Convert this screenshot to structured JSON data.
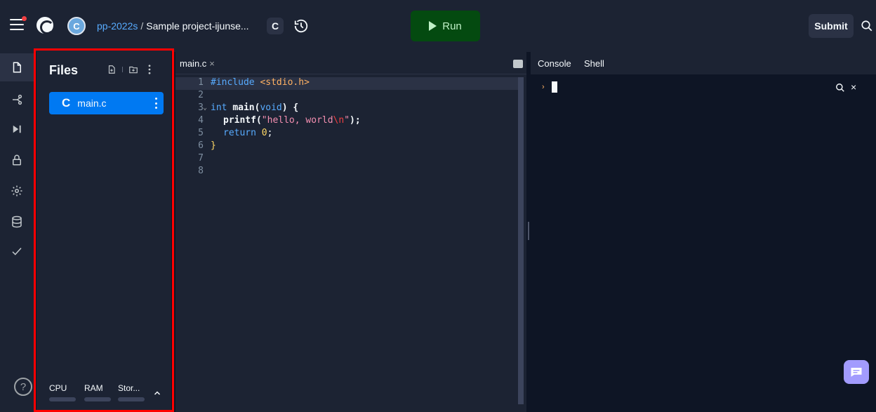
{
  "header": {
    "owner": "pp-2022s",
    "separator": "/",
    "project": "Sample project-ijunse...",
    "language_badge": "C",
    "run_label": "Run",
    "submit_label": "Submit",
    "avatar_letter": "C"
  },
  "files": {
    "title": "Files",
    "items": [
      {
        "icon": "C",
        "name": "main.c"
      }
    ],
    "resources": [
      "CPU",
      "RAM",
      "Stor..."
    ]
  },
  "editor": {
    "tab": "main.c",
    "tab_close": "×",
    "lines": [
      {
        "n": "1"
      },
      {
        "n": "2"
      },
      {
        "n": "3"
      },
      {
        "n": "4"
      },
      {
        "n": "5"
      },
      {
        "n": "6"
      },
      {
        "n": "7"
      },
      {
        "n": "8"
      }
    ],
    "code": {
      "include": "#include",
      "header_file": "<stdio.h>",
      "int": "int",
      "main": "main(",
      "void": "void",
      "close_paren": ") {",
      "printf": "printf(",
      "str_a": "\"hello, world",
      "escape": "\\n",
      "str_b": "\"",
      "close_call": ");",
      "return": "return",
      "zero": "0",
      "semi": ";",
      "close_brace": "}"
    }
  },
  "console": {
    "tabs": [
      "Console",
      "Shell"
    ],
    "prompt": "›",
    "close": "×"
  },
  "help_label": "?",
  "colors": {
    "accent_blue": "#0079f2",
    "run_green": "#044a10",
    "highlight_red": "#ff0000",
    "feedback_purple": "#a29bfe"
  }
}
